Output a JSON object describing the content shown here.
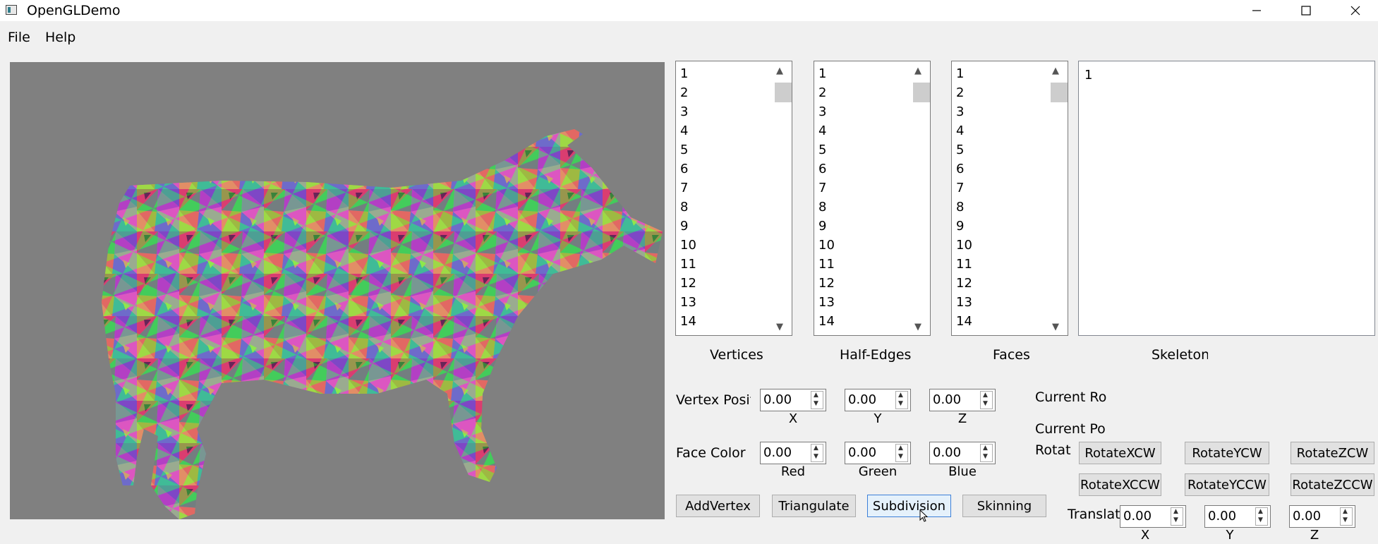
{
  "window": {
    "title": "OpenGLDemo"
  },
  "icons": [
    "app-icon",
    "minimize-icon",
    "maximize-icon",
    "close-icon",
    "scroll-up-icon",
    "scroll-down-icon",
    "spin-up-icon",
    "spin-down-icon",
    "mouse-cursor-icon"
  ],
  "menu": {
    "file": "File",
    "help": "Help"
  },
  "lists": {
    "vertices": {
      "items": [
        "1",
        "2",
        "3",
        "4",
        "5",
        "6",
        "7",
        "8",
        "9",
        "10",
        "11",
        "12",
        "13",
        "14"
      ],
      "caption": "Vertices"
    },
    "half_edges": {
      "items": [
        "1",
        "2",
        "3",
        "4",
        "5",
        "6",
        "7",
        "8",
        "9",
        "10",
        "11",
        "12",
        "13",
        "14"
      ],
      "caption": "Half-Edges"
    },
    "faces": {
      "items": [
        "1",
        "2",
        "3",
        "4",
        "5",
        "6",
        "7",
        "8",
        "9",
        "10",
        "11",
        "12",
        "13",
        "14"
      ],
      "caption": "Faces"
    },
    "skeletons": {
      "items": [
        "1"
      ],
      "caption": "Skeleton:"
    }
  },
  "vertex_position": {
    "label": "Vertex Positi",
    "x": "0.00",
    "y": "0.00",
    "z": "0.00",
    "x_label": "X",
    "y_label": "Y",
    "z_label": "Z"
  },
  "face_color": {
    "label": "Face Color",
    "red": "0.00",
    "green": "0.00",
    "blue": "0.00",
    "red_label": "Red",
    "green_label": "Green",
    "blue_label": "Blue"
  },
  "buttons": {
    "add_vertex": "AddVertex",
    "triangulate": "Triangulate",
    "subdivision": "Subdivision",
    "skinning": "Skinning"
  },
  "joint": {
    "current_rotation": "Current Ro",
    "current_position": "Current Po",
    "rotate_label": "Rotat",
    "rotate_x_cw": "RotateXCW",
    "rotate_y_cw": "RotateYCW",
    "rotate_z_cw": "RotateZCW",
    "rotate_x_ccw": "RotateXCCW",
    "rotate_y_ccw": "RotateYCCW",
    "rotate_z_ccw": "RotateZCCW",
    "translate_label": "Translate",
    "tx": "0.00",
    "ty": "0.00",
    "tz": "0.00",
    "tx_label": "X",
    "ty_label": "Y",
    "tz_label": "Z"
  }
}
